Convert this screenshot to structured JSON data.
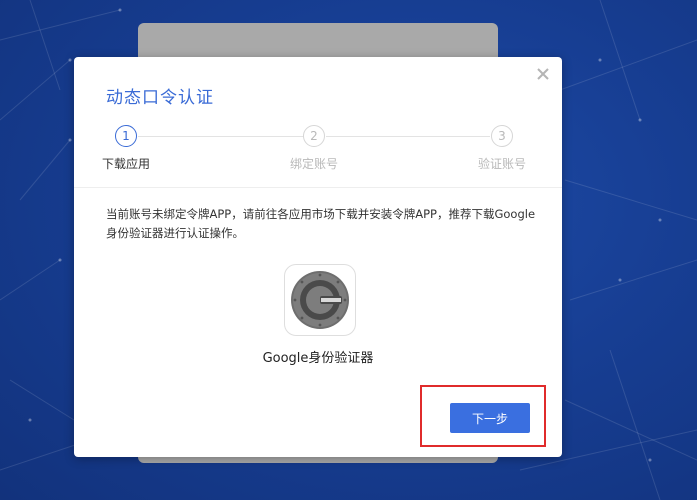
{
  "colors": {
    "accent": "#3a6bd6",
    "button": "#3a6fe0",
    "highlight": "#e02b2b",
    "backdrop": "#173e93"
  },
  "dialog": {
    "title": "动态口令认证",
    "close_icon": "close-icon",
    "steps": [
      {
        "number": "1",
        "label": "下载应用",
        "active": true
      },
      {
        "number": "2",
        "label": "绑定账号",
        "active": false
      },
      {
        "number": "3",
        "label": "验证账号",
        "active": false
      }
    ],
    "description": "当前账号未绑定令牌APP，请前往各应用市场下载并安装令牌APP，推荐下载Google身份验证器进行认证操作。",
    "app_icon": "google-authenticator-icon",
    "app_name": "Google身份验证器",
    "next_button_label": "下一步"
  }
}
